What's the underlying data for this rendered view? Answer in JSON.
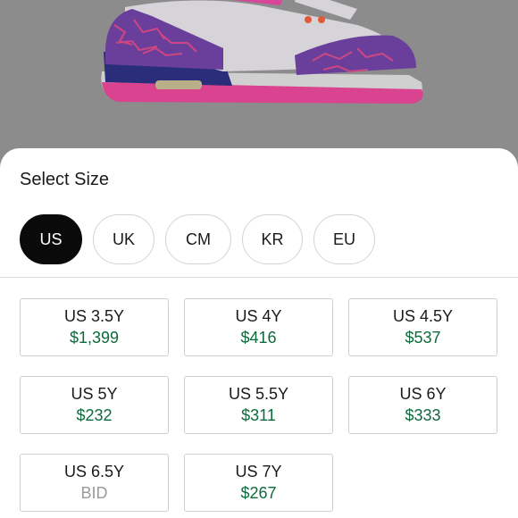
{
  "product_image": {
    "alt": "sneaker"
  },
  "sheet": {
    "title": "Select Size",
    "regions": [
      {
        "label": "US",
        "active": true
      },
      {
        "label": "UK",
        "active": false
      },
      {
        "label": "CM",
        "active": false
      },
      {
        "label": "KR",
        "active": false
      },
      {
        "label": "EU",
        "active": false
      }
    ],
    "sizes": [
      {
        "label": "US 3.5Y",
        "price": "$1,399"
      },
      {
        "label": "US 4Y",
        "price": "$416"
      },
      {
        "label": "US 4.5Y",
        "price": "$537"
      },
      {
        "label": "US 5Y",
        "price": "$232"
      },
      {
        "label": "US 5.5Y",
        "price": "$311"
      },
      {
        "label": "US 6Y",
        "price": "$333"
      },
      {
        "label": "US 6.5Y",
        "price": "BID"
      },
      {
        "label": "US 7Y",
        "price": "$267"
      }
    ]
  },
  "colors": {
    "price_green": "#0b6b3a",
    "bid_gray": "#9b9b9b",
    "active_pill": "#0a0a0a"
  }
}
